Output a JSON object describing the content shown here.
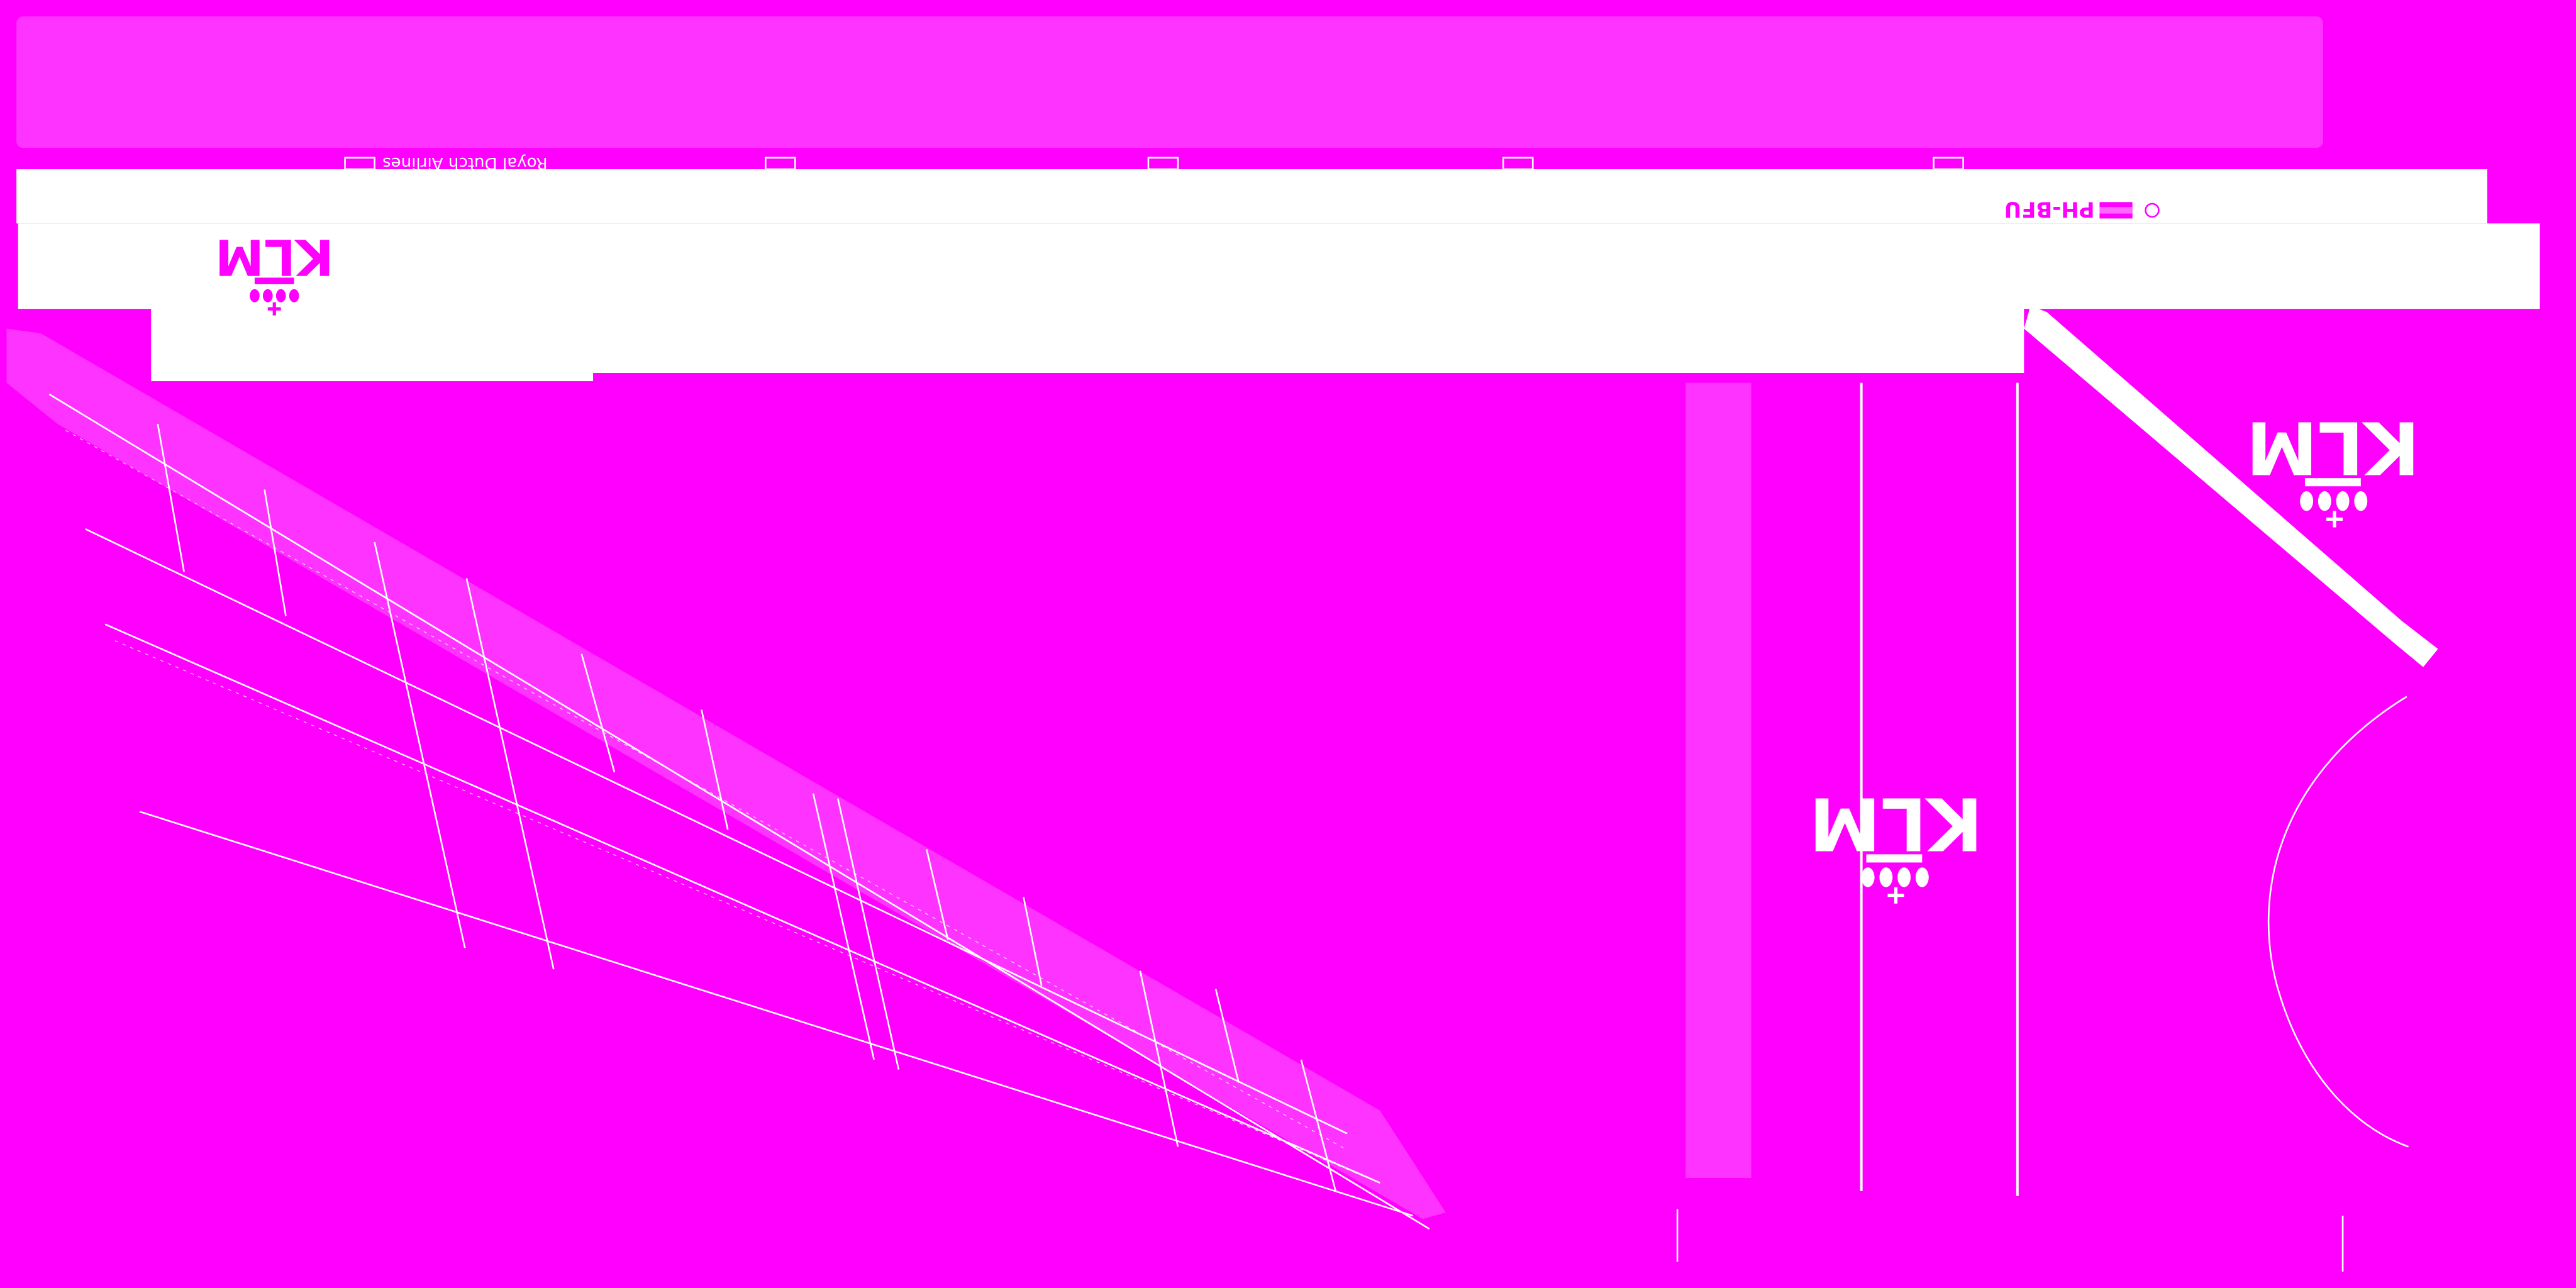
{
  "texture": {
    "background_color": "#ff00ff",
    "panel_color": "#ffffff",
    "highlight_color": "#ff33ff",
    "seam_color": "#ffffff"
  },
  "fuselage": {
    "brand_text": "Royal Dutch Airlines",
    "registration": "PH-BFU",
    "flag_colors": [
      "#ff33ff",
      "#ffffff",
      "#ff33ff"
    ]
  },
  "logos": {
    "wordmark": "KLM",
    "crown_icon": "crown-icon"
  }
}
